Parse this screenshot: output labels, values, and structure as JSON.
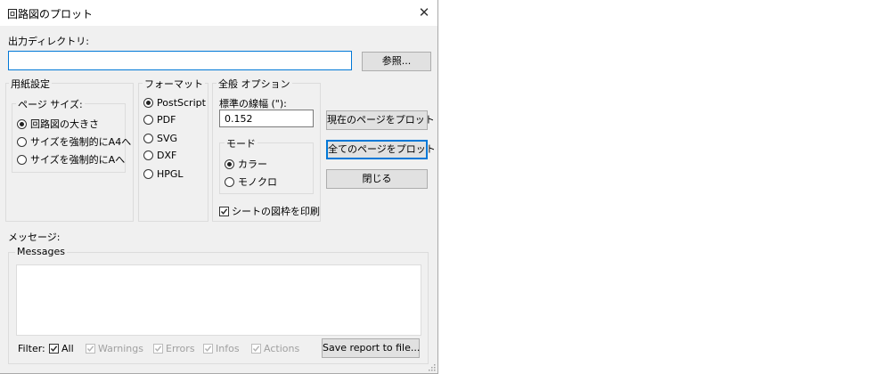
{
  "window": {
    "title": "回路図のプロット",
    "close_glyph": "✕"
  },
  "output_dir": {
    "label": "出力ディレクトリ:",
    "value": "",
    "browse_label": "参照..."
  },
  "paper": {
    "group_label": "用紙設定",
    "page_size_label": "ページ サイズ:",
    "options": [
      {
        "label": "回路図の大きさ",
        "selected": true
      },
      {
        "label": "サイズを強制的にA4へ",
        "selected": false
      },
      {
        "label": "サイズを強制的にAへ",
        "selected": false
      }
    ]
  },
  "format": {
    "group_label": "フォーマット",
    "options": [
      {
        "label": "PostScript",
        "selected": true
      },
      {
        "label": "PDF",
        "selected": false
      },
      {
        "label": "SVG",
        "selected": false
      },
      {
        "label": "DXF",
        "selected": false
      },
      {
        "label": "HPGL",
        "selected": false
      }
    ]
  },
  "general": {
    "group_label": "全般 オプション",
    "line_width_label": "標準の線幅 (\"):",
    "line_width_value": "0.152",
    "mode_label": "モード",
    "mode_options": [
      {
        "label": "カラー",
        "selected": true
      },
      {
        "label": "モノクロ",
        "selected": false
      }
    ],
    "print_frame_label": "シートの図枠を印刷",
    "print_frame_checked": true
  },
  "actions": {
    "plot_current": "現在のページをプロット",
    "plot_all": "全てのページをプロット",
    "close": "閉じる"
  },
  "messages": {
    "section_label": "メッセージ:",
    "group_label": "Messages",
    "filter_label": "Filter:",
    "filters": [
      {
        "label": "All",
        "checked": true,
        "enabled": true
      },
      {
        "label": "Warnings",
        "checked": true,
        "enabled": false
      },
      {
        "label": "Errors",
        "checked": true,
        "enabled": false
      },
      {
        "label": "Infos",
        "checked": true,
        "enabled": false
      },
      {
        "label": "Actions",
        "checked": true,
        "enabled": false
      }
    ],
    "save_report": "Save report to file..."
  }
}
